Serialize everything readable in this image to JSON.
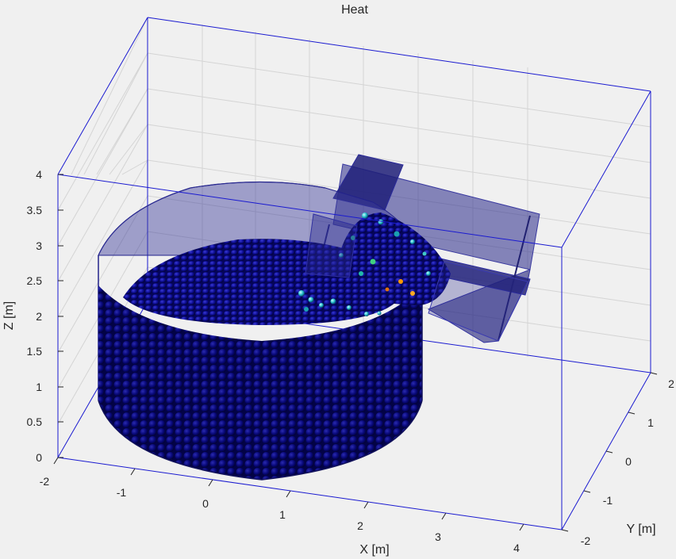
{
  "chart_data": {
    "type": "scatter3d",
    "title": "Heat",
    "xlabel": "X [m]",
    "ylabel": "Y [m]",
    "zlabel": "Z [m]",
    "xlim": [
      -2,
      4.5
    ],
    "ylim": [
      -2,
      2
    ],
    "zlim": [
      0,
      4
    ],
    "xticks": [
      "-2",
      "-1",
      "0",
      "1",
      "2",
      "3",
      "4"
    ],
    "yticks": [
      "-2",
      "-1",
      "0",
      "1",
      "2"
    ],
    "zticks": [
      "0",
      "0.5",
      "1",
      "1.5",
      "2",
      "2.5",
      "3",
      "3.5",
      "4"
    ],
    "grid": true,
    "colors": {
      "background": "#f0f0f0",
      "box_edges": "#0000cc",
      "grid": "#d9d9d9",
      "geometry_fill": "#1a1a6e",
      "particles_low": "#00008b",
      "particles_mid": "#00c8c8",
      "particles_high": "#ffa500"
    },
    "objects": [
      {
        "name": "cylindrical drum",
        "center_x": 0,
        "center_y": 0,
        "radius": 1.5,
        "height": 3.2
      },
      {
        "name": "feed chute",
        "from_x": 2.5,
        "to_x": 4.5,
        "y": 0,
        "z_range": [
          2.4,
          4.0
        ]
      }
    ]
  }
}
